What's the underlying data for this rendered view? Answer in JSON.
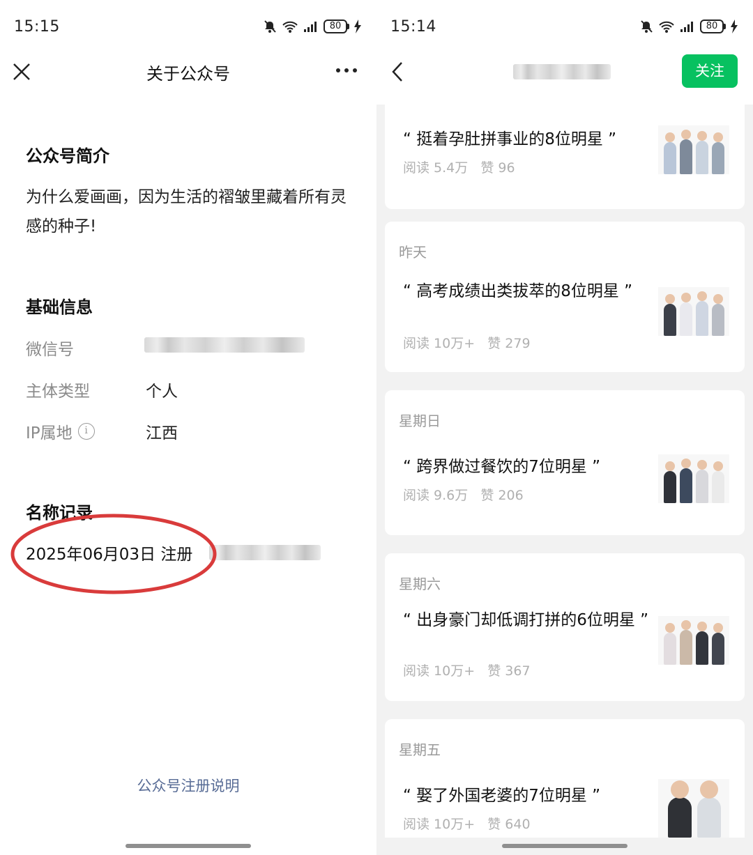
{
  "left": {
    "status_bar": {
      "time": "15:15",
      "battery": "80"
    },
    "nav": {
      "title": "关于公众号"
    },
    "intro": {
      "heading": "公众号简介",
      "text": "为什么爱画画，因为生活的褶皱里藏着所有灵感的种子!"
    },
    "basic_info": {
      "heading": "基础信息",
      "wechat_id_label": "微信号",
      "entity_type_label": "主体类型",
      "entity_type_value": "个人",
      "ip_label": "IP属地",
      "ip_value": "江西"
    },
    "name_history": {
      "heading": "名称记录",
      "registration": "2025年06月03日 注册"
    },
    "footer_link": "公众号注册说明"
  },
  "right": {
    "status_bar": {
      "time": "15:14",
      "battery": "80"
    },
    "nav": {
      "follow_label": "关注"
    },
    "articles": [
      {
        "day": "",
        "title": "“ 挺着孕肚拼事业的8位明星 ”",
        "reads": "阅读 5.4万",
        "likes": "赞 96"
      },
      {
        "day": "昨天",
        "title": "“ 高考成绩出类拔萃的8位明星 ”",
        "reads": "阅读 10万+",
        "likes": "赞 279"
      },
      {
        "day": "星期日",
        "title": "“ 跨界做过餐饮的7位明星 ”",
        "reads": "阅读 9.6万",
        "likes": "赞 206"
      },
      {
        "day": "星期六",
        "title": "“ 出身豪门却低调打拼的6位明星 ”",
        "reads": "阅读 10万+",
        "likes": "赞 367"
      },
      {
        "day": "星期五",
        "title": "“ 娶了外国老婆的7位明星 ”",
        "reads": "阅读 10万+",
        "likes": "赞 640"
      }
    ]
  },
  "colors": {
    "accent_green": "#07c160",
    "link_blue": "#576b95",
    "annotation_red": "#d93b3b"
  }
}
